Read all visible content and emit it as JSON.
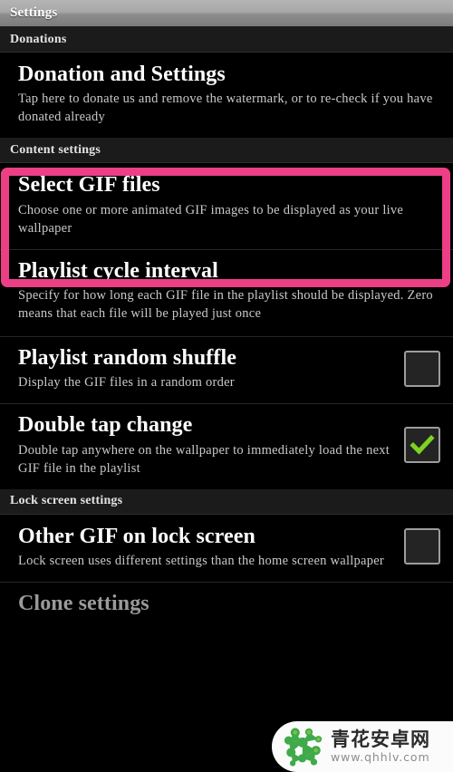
{
  "window": {
    "title": "Settings"
  },
  "colors": {
    "highlight_box": "#ec3f85",
    "checkbox_checked": "#7ed321",
    "section_header_bg": "#1b1b1b",
    "titlebar_top": "#b4b4b4",
    "titlebar_bottom": "#7b7b7b",
    "watermark_logo_green": "#3faa4a"
  },
  "sections": [
    {
      "header": "Donations",
      "rows": [
        {
          "title": "Donation and Settings",
          "summary": "Tap here to donate us and remove the watermark, or to re-check if you have donated already",
          "widget": "none"
        }
      ]
    },
    {
      "header": "Content settings",
      "rows": [
        {
          "title": "Select GIF files",
          "summary": "Choose one or more animated GIF images to be displayed as your live wallpaper",
          "widget": "none",
          "highlighted": true
        },
        {
          "title": "Playlist cycle interval",
          "summary": "Specify for how long each GIF file in the playlist should be displayed. Zero means that each file will be played just once",
          "widget": "none"
        },
        {
          "title": "Playlist random shuffle",
          "summary": "Display the GIF files in a random order",
          "widget": "checkbox",
          "checked": false
        },
        {
          "title": "Double tap change",
          "summary": "Double tap anywhere on the wallpaper to immediately load the next GIF file in the playlist",
          "widget": "checkbox",
          "checked": true
        }
      ]
    },
    {
      "header": "Lock screen settings",
      "rows": [
        {
          "title": "Other GIF on lock screen",
          "summary": "Lock screen uses different settings than the home screen wallpaper",
          "widget": "checkbox",
          "checked": false
        },
        {
          "title": "Clone settings",
          "summary": "",
          "widget": "none",
          "dim": true
        }
      ]
    }
  ],
  "watermark": {
    "brand_cn": "青花安卓网",
    "url": "www.qhhlv.com"
  }
}
